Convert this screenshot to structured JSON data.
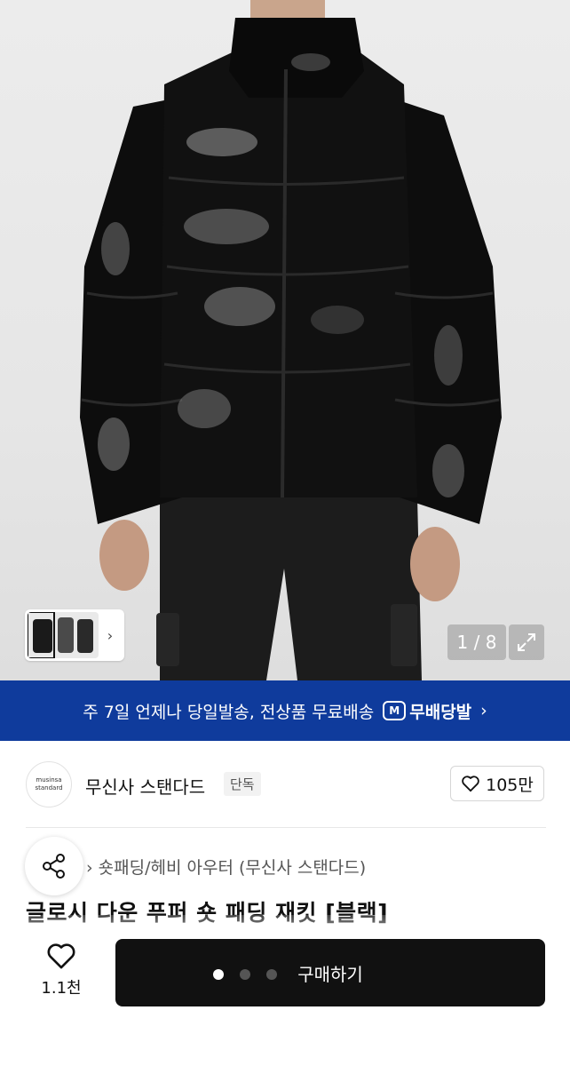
{
  "gallery": {
    "counter": "1 / 8",
    "thumb_chevron": "›"
  },
  "shipping_banner": {
    "text": "주 7일 언제나 당일발송, 전상품 무료배송",
    "badge_icon_text": "M",
    "badge_label": "무배당발",
    "chevron": "›",
    "color": "#0f3b9c"
  },
  "brand": {
    "logo_line1": "musinsa",
    "logo_line2": "standard",
    "name": "무신사 스탠다드",
    "tag": "단독",
    "like_count": "105만"
  },
  "product": {
    "category": "› 숏패딩/헤비 아우터 (무신사 스탠다드)",
    "title": "글로시 다운 푸퍼 숏 패딩 재킷 [블랙]"
  },
  "bottom_bar": {
    "wish_count": "1.1천",
    "buy_label": "구매하기",
    "carousel_dots": 3,
    "active_dot": 0
  },
  "icons": {
    "share": "share-icon",
    "heart": "heart-icon",
    "expand": "expand-icon"
  }
}
